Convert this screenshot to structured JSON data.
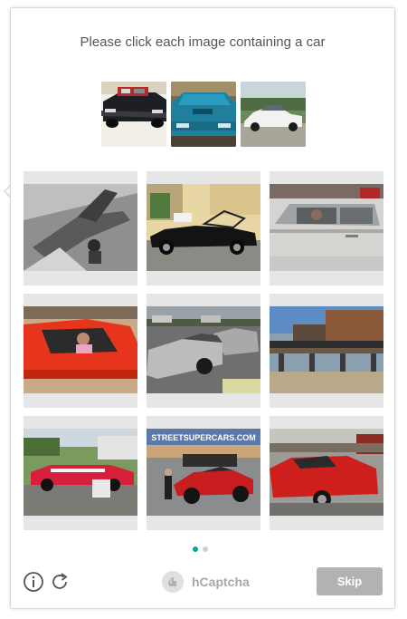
{
  "prompt": "Please click each image containing a car",
  "examples": [
    {
      "icon": "example-black-car-engine-image"
    },
    {
      "icon": "example-blue-car-image"
    },
    {
      "icon": "example-white-car-image"
    }
  ],
  "tiles": [
    {
      "icon": "airplane-grayscale-image"
    },
    {
      "icon": "black-convertible-image"
    },
    {
      "icon": "silver-car-interior-image"
    },
    {
      "icon": "red-car-interior-image"
    },
    {
      "icon": "silver-delorean-image"
    },
    {
      "icon": "freight-train-image"
    },
    {
      "icon": "red-mustang-convertible-image"
    },
    {
      "icon": "red-bugatti-image"
    },
    {
      "icon": "red-ferrari-image"
    }
  ],
  "thumb_banner": "STREETSUPERCARS.COM",
  "pagination": {
    "active_page": 1,
    "total_pages": 2
  },
  "footer": {
    "info_icon": "info-icon",
    "refresh_icon": "refresh-icon",
    "brand": "hCaptcha",
    "skip_label": "Skip"
  },
  "colors": {
    "accent": "#00a98f",
    "skip_bg": "#b2b2b2",
    "tile_bg": "#e6e6e6",
    "prompt_text": "#555555"
  }
}
